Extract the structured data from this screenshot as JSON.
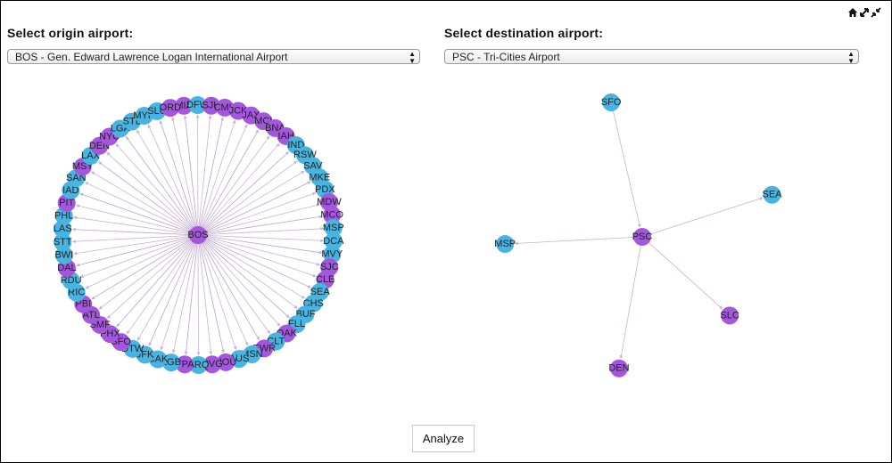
{
  "toolbar": {
    "icons": [
      "home-icon",
      "zoom-in-icon",
      "zoom-out-icon"
    ]
  },
  "origin": {
    "label": "Select origin airport:",
    "selected": "BOS - Gen. Edward Lawrence Logan International Airport"
  },
  "destination": {
    "label": "Select destination airport:",
    "selected": "PSC - Tri-Cities Airport"
  },
  "colors": {
    "blue": "#47b4e1",
    "purple": "#a457de",
    "edge": "#c9b2cf"
  },
  "origin_graph": {
    "hub": {
      "code": "BOS",
      "color": "purple"
    },
    "nodes": [
      {
        "code": "MIA",
        "color": "purple"
      },
      {
        "code": "DFW",
        "color": "blue"
      },
      {
        "code": "SJU",
        "color": "purple"
      },
      {
        "code": "CMH",
        "color": "purple"
      },
      {
        "code": "JCK",
        "color": "purple"
      },
      {
        "code": "JAX",
        "color": "purple"
      },
      {
        "code": "MCI",
        "color": "purple"
      },
      {
        "code": "BNA",
        "color": "purple"
      },
      {
        "code": "IAH",
        "color": "purple"
      },
      {
        "code": "IND",
        "color": "blue"
      },
      {
        "code": "RSW",
        "color": "blue"
      },
      {
        "code": "SAV",
        "color": "blue"
      },
      {
        "code": "MKE",
        "color": "blue"
      },
      {
        "code": "PDX",
        "color": "blue"
      },
      {
        "code": "MDW",
        "color": "purple"
      },
      {
        "code": "MCO",
        "color": "purple"
      },
      {
        "code": "MSP",
        "color": "blue"
      },
      {
        "code": "DCA",
        "color": "blue"
      },
      {
        "code": "MVY",
        "color": "blue"
      },
      {
        "code": "SJC",
        "color": "purple"
      },
      {
        "code": "CLE",
        "color": "purple"
      },
      {
        "code": "SEA",
        "color": "blue"
      },
      {
        "code": "CHS",
        "color": "blue"
      },
      {
        "code": "BUF",
        "color": "blue"
      },
      {
        "code": "FLL",
        "color": "blue"
      },
      {
        "code": "OAK",
        "color": "purple"
      },
      {
        "code": "CLT",
        "color": "blue"
      },
      {
        "code": "EWR",
        "color": "purple"
      },
      {
        "code": "MSN",
        "color": "blue"
      },
      {
        "code": "AUS",
        "color": "blue"
      },
      {
        "code": "HOU",
        "color": "purple"
      },
      {
        "code": "CVG",
        "color": "purple"
      },
      {
        "code": "SRQ",
        "color": "blue"
      },
      {
        "code": "TPA",
        "color": "purple"
      },
      {
        "code": "LGB",
        "color": "blue"
      },
      {
        "code": "CAK",
        "color": "blue"
      },
      {
        "code": "JFK",
        "color": "blue"
      },
      {
        "code": "DTW",
        "color": "blue"
      },
      {
        "code": "SFO",
        "color": "purple"
      },
      {
        "code": "PHX",
        "color": "purple"
      },
      {
        "code": "SMF",
        "color": "purple"
      },
      {
        "code": "ATL",
        "color": "purple"
      },
      {
        "code": "PBI",
        "color": "purple"
      },
      {
        "code": "RIC",
        "color": "blue"
      },
      {
        "code": "RDU",
        "color": "blue"
      },
      {
        "code": "DAL",
        "color": "purple"
      },
      {
        "code": "BWI",
        "color": "blue"
      },
      {
        "code": "STT",
        "color": "blue"
      },
      {
        "code": "LAS",
        "color": "blue"
      },
      {
        "code": "PHL",
        "color": "blue"
      },
      {
        "code": "PIT",
        "color": "purple"
      },
      {
        "code": "IAD",
        "color": "blue"
      },
      {
        "code": "SAN",
        "color": "blue"
      },
      {
        "code": "MSY",
        "color": "purple"
      },
      {
        "code": "LAX",
        "color": "blue"
      },
      {
        "code": "DEN",
        "color": "purple"
      },
      {
        "code": "NYC",
        "color": "purple"
      },
      {
        "code": "LGA",
        "color": "blue"
      },
      {
        "code": "STL",
        "color": "blue"
      },
      {
        "code": "MYR",
        "color": "blue"
      },
      {
        "code": "SLC",
        "color": "blue"
      },
      {
        "code": "ORD",
        "color": "purple"
      }
    ]
  },
  "destination_graph": {
    "hub": {
      "code": "PSC",
      "color": "purple"
    },
    "nodes": [
      {
        "code": "SFO",
        "color": "blue",
        "dir": "in"
      },
      {
        "code": "SEA",
        "color": "blue",
        "dir": "out"
      },
      {
        "code": "MSP",
        "color": "blue",
        "dir": "out"
      },
      {
        "code": "SLC",
        "color": "purple",
        "dir": "out"
      },
      {
        "code": "DEN",
        "color": "purple",
        "dir": "out"
      }
    ]
  },
  "analyze_button": {
    "label": "Analyze"
  }
}
